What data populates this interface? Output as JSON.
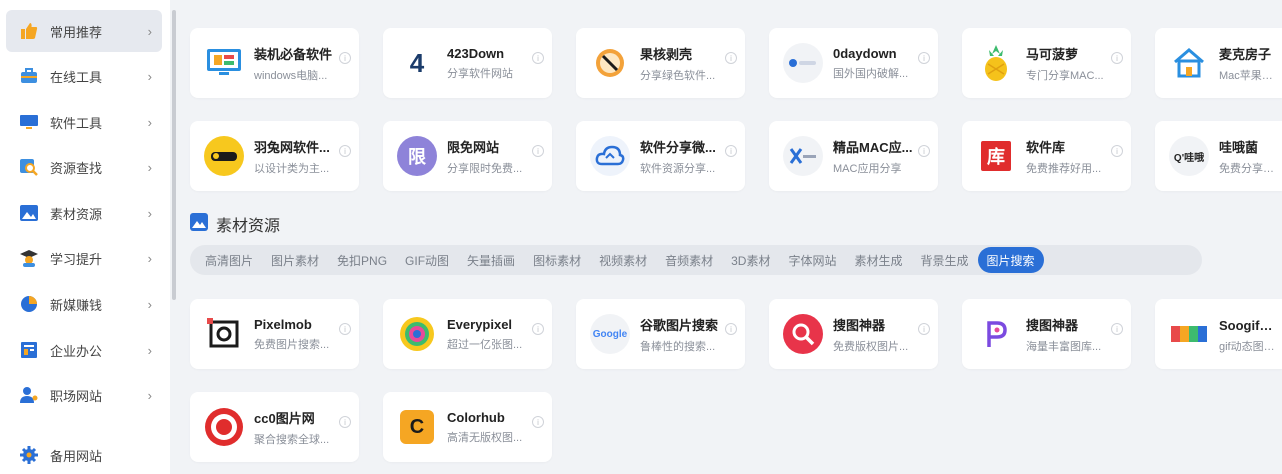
{
  "sidebar": {
    "items": [
      {
        "label": "常用推荐",
        "icon": "thumbs-up-icon",
        "active": true
      },
      {
        "label": "在线工具",
        "icon": "toolbox-icon"
      },
      {
        "label": "软件工具",
        "icon": "monitor-icon"
      },
      {
        "label": "资源查找",
        "icon": "search-icon"
      },
      {
        "label": "素材资源",
        "icon": "image-icon"
      },
      {
        "label": "学习提升",
        "icon": "graduate-icon"
      },
      {
        "label": "新媒赚钱",
        "icon": "pie-chart-icon"
      },
      {
        "label": "企业办公",
        "icon": "building-icon"
      },
      {
        "label": "职场网站",
        "icon": "user-icon"
      },
      {
        "label": "备用网站",
        "icon": "gear-icon"
      }
    ],
    "chevron": "›"
  },
  "recommend": {
    "row1": [
      {
        "title": "装机必备软件",
        "desc": "windows电脑..."
      },
      {
        "title": "423Down",
        "desc": "分享软件网站"
      },
      {
        "title": "果核剥壳",
        "desc": "分享绿色软件..."
      },
      {
        "title": "0daydown",
        "desc": "国外国内破解..."
      },
      {
        "title": "马可菠萝",
        "desc": "专门分享MAC..."
      },
      {
        "title": "麦克房子",
        "desc": "Mac苹果电脑..."
      }
    ],
    "row2": [
      {
        "title": "羽兔网软件...",
        "desc": "以设计类为主..."
      },
      {
        "title": "限免网站",
        "desc": "分享限时免费..."
      },
      {
        "title": "软件分享微...",
        "desc": "软件资源分享..."
      },
      {
        "title": "精品MAC应...",
        "desc": "MAC应用分享"
      },
      {
        "title": "软件库",
        "desc": "免费推荐好用..."
      },
      {
        "title": "哇哦菌",
        "desc": "免费分享各种..."
      }
    ],
    "icon_text": {
      "four23": "4",
      "xianmian": "限",
      "ku": "库",
      "wa": "Q'哇哦"
    }
  },
  "section": {
    "title": "素材资源"
  },
  "tabs": [
    {
      "label": "高清图片"
    },
    {
      "label": "图片素材"
    },
    {
      "label": "免扣PNG"
    },
    {
      "label": "GIF动图"
    },
    {
      "label": "矢量插画"
    },
    {
      "label": "图标素材"
    },
    {
      "label": "视频素材"
    },
    {
      "label": "音频素材"
    },
    {
      "label": "3D素材"
    },
    {
      "label": "字体网站"
    },
    {
      "label": "素材生成"
    },
    {
      "label": "背景生成"
    },
    {
      "label": "图片搜索",
      "active": true
    }
  ],
  "images": {
    "row1": [
      {
        "title": "Pixelmob",
        "desc": "免费图片搜索..."
      },
      {
        "title": "Everypixel",
        "desc": "超过一亿张图..."
      },
      {
        "title": "谷歌图片搜索",
        "desc": "鲁棒性的搜索..."
      },
      {
        "title": "搜图神器",
        "desc": "免费版权图片..."
      },
      {
        "title": "搜图神器",
        "desc": "海量丰富图库..."
      },
      {
        "title": "Soogif动图",
        "desc": "gif动态图片..."
      }
    ],
    "row2": [
      {
        "title": "cc0图片网",
        "desc": "聚合搜索全球..."
      },
      {
        "title": "Colorhub",
        "desc": "高清无版权图..."
      }
    ],
    "icon_text": {
      "google": "Google",
      "colorhub": "C"
    }
  },
  "colors": {
    "accent": "#2a6fd6",
    "background": "#f1f3f6"
  }
}
